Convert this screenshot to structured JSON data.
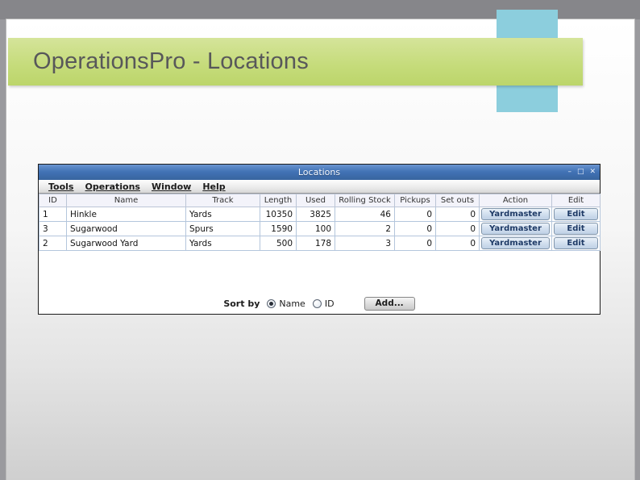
{
  "slide": {
    "title": "OperationsPro - Locations"
  },
  "app": {
    "title": "Locations",
    "titlebar_icons": {
      "minimize": "–",
      "maximize": "□",
      "close": "✕"
    },
    "menu": {
      "items": [
        "Tools",
        "Operations",
        "Window",
        "Help"
      ]
    },
    "table": {
      "columns": [
        "ID",
        "Name",
        "Track",
        "Length",
        "Used",
        "Rolling Stock",
        "Pickups",
        "Set outs",
        "Action",
        "Edit"
      ],
      "rows": [
        {
          "id": "1",
          "name": "Hinkle",
          "track": "Yards",
          "length": "10350",
          "used": "3825",
          "rolling_stock": "46",
          "pickups": "0",
          "set_outs": "0",
          "action": "Yardmaster",
          "edit": "Edit"
        },
        {
          "id": "3",
          "name": "Sugarwood",
          "track": "Spurs",
          "length": "1590",
          "used": "100",
          "rolling_stock": "2",
          "pickups": "0",
          "set_outs": "0",
          "action": "Yardmaster",
          "edit": "Edit"
        },
        {
          "id": "2",
          "name": "Sugarwood Yard",
          "track": "Yards",
          "length": "500",
          "used": "178",
          "rolling_stock": "3",
          "pickups": "0",
          "set_outs": "0",
          "action": "Yardmaster",
          "edit": "Edit"
        }
      ]
    },
    "footer": {
      "sort_label": "Sort by",
      "name_option": "Name",
      "id_option": "ID",
      "sort_selected": "Name",
      "add_label": "Add..."
    }
  },
  "colors": {
    "slide_accent_green": "#c6dc7c",
    "slide_accent_teal": "#8ccedd",
    "titlebar_blue": "#4273b6",
    "button_text_navy": "#1e3a66",
    "grid_line": "#b4c6dc"
  }
}
